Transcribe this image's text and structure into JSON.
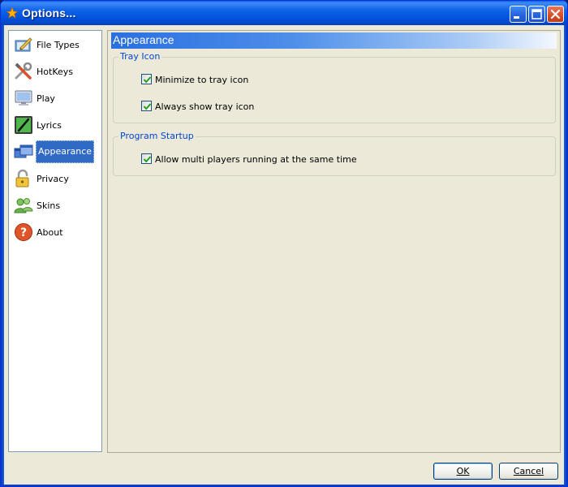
{
  "window": {
    "title": "Options..."
  },
  "sidebar": {
    "items": [
      {
        "label": "File Types",
        "icon": "file-types-icon"
      },
      {
        "label": "HotKeys",
        "icon": "hotkeys-tools-icon"
      },
      {
        "label": "Play",
        "icon": "monitor-icon"
      },
      {
        "label": "Lyrics",
        "icon": "lyrics-pen-icon"
      },
      {
        "label": "Appearance",
        "icon": "windows-icon",
        "selected": true
      },
      {
        "label": "Privacy",
        "icon": "lock-icon"
      },
      {
        "label": "Skins",
        "icon": "users-icon"
      },
      {
        "label": "About",
        "icon": "help-icon"
      }
    ]
  },
  "panel": {
    "title": "Appearance",
    "groups": [
      {
        "legend": "Tray Icon",
        "options": [
          {
            "label": "Minimize to tray icon",
            "checked": true
          },
          {
            "label": "Always show tray icon",
            "checked": true
          }
        ]
      },
      {
        "legend": "Program Startup",
        "options": [
          {
            "label": "Allow multi players running at the same time",
            "checked": true
          }
        ]
      }
    ]
  },
  "buttons": {
    "ok": "OK",
    "cancel": "Cancel"
  },
  "colors": {
    "titlebar": "#0a5fe6",
    "selection": "#316ac5",
    "legend": "#0046d5",
    "close": "#d9502b"
  }
}
